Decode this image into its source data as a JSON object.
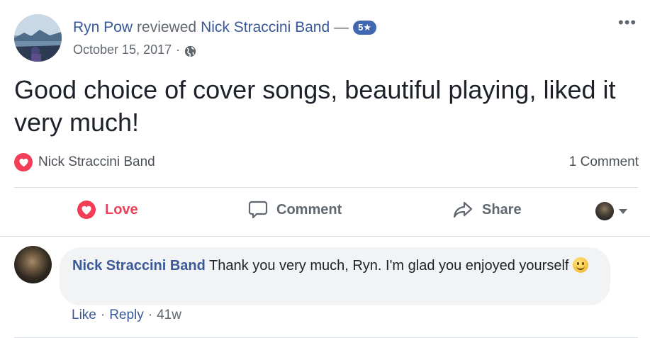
{
  "post": {
    "author": "Ryn Pow",
    "reviewed_word": "reviewed",
    "page_name": "Nick Straccini Band",
    "dash": "—",
    "rating_badge": "5★",
    "date": "October 15, 2017",
    "meta_separator": "·",
    "privacy_icon": "globe-icon",
    "more_icon": "•••",
    "review_text": "Good choice of cover songs, beautiful playing, liked it very much!",
    "recommends_page": "Nick Straccini Band",
    "comment_count": "1 Comment"
  },
  "actions": {
    "love": "Love",
    "comment": "Comment",
    "share": "Share"
  },
  "comment": {
    "author": "Nick Straccini Band",
    "text": "Thank you very much, Ryn. I'm glad you enjoyed yourself",
    "emoji": "smile-emoji",
    "like": "Like",
    "reply": "Reply",
    "separator": "·",
    "age": "41w"
  },
  "colors": {
    "link": "#385898",
    "love": "#f33e58",
    "badge": "#4267b2",
    "muted": "#616770",
    "bubble": "#f2f3f5"
  }
}
